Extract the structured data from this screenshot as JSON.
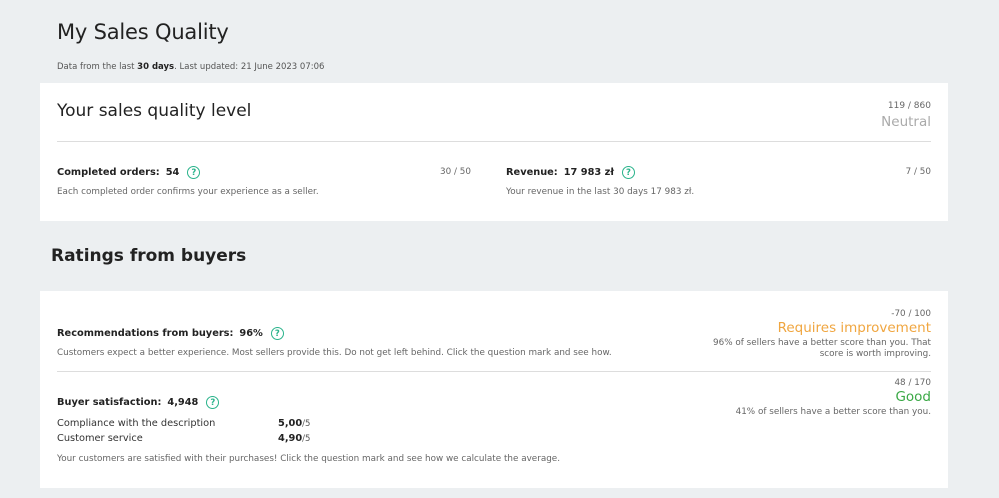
{
  "header": {
    "title": "My Sales Quality",
    "subtitle_prefix": "Data from the last ",
    "subtitle_bold": "30 days",
    "subtitle_suffix": ". Last updated: 21 June 2023 07:06"
  },
  "level_card": {
    "heading": "Your sales quality level",
    "score": "119 / 860",
    "level": "Neutral",
    "completed_orders": {
      "label": "Completed orders:",
      "value": "54",
      "score": "30 / 50",
      "description": "Each completed order confirms your experience as a seller."
    },
    "revenue": {
      "label": "Revenue:",
      "value": "17 983 zł",
      "score": "7 / 50",
      "description": "Your revenue in the last 30 days 17 983 zł."
    }
  },
  "ratings_section": {
    "heading": "Ratings from buyers"
  },
  "ratings_card": {
    "recommendations": {
      "label": "Recommendations from buyers:",
      "value": "96%",
      "description": "Customers expect a better experience. Most sellers provide this. Do not get left behind. Click the question mark and see how.",
      "score": "-70 / 100",
      "status": "Requires improvement",
      "status_color": "#f0a640",
      "note_line1": "96% of sellers have a better score than you. That",
      "note_line2": "score is worth improving."
    },
    "satisfaction": {
      "label": "Buyer satisfaction:",
      "value": "4,948",
      "score": "48 / 170",
      "status": "Good",
      "status_color": "#3aa845",
      "note": "41% of sellers have a better score than you.",
      "rows": [
        {
          "name": "Compliance with the description",
          "value": "5,00",
          "max": "/5"
        },
        {
          "name": "Customer service",
          "value": "4,90",
          "max": "/5"
        }
      ],
      "description": "Your customers are satisfied with their purchases! Click the question mark and see how we calculate the average."
    }
  },
  "icons": {
    "help": "?"
  }
}
